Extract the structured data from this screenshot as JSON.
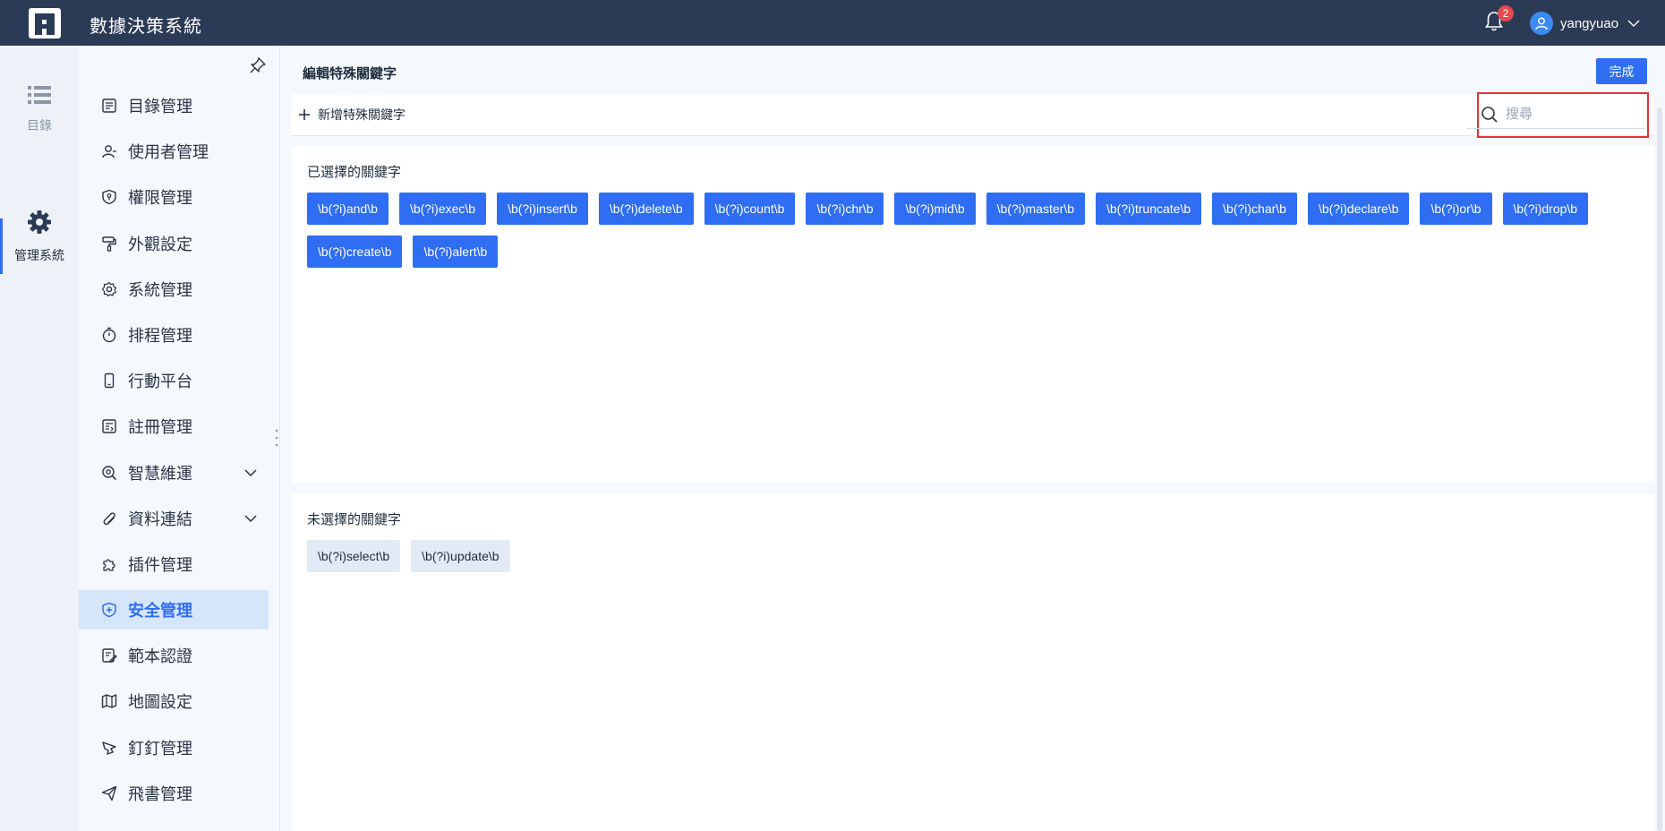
{
  "header": {
    "title": "數據決策系統",
    "notification_count": "2",
    "username": "yangyuao"
  },
  "rail": {
    "items": [
      {
        "label": "目錄",
        "icon": "list-icon"
      },
      {
        "label": "管理系統",
        "icon": "gear-icon"
      }
    ]
  },
  "sidebar": {
    "items": [
      {
        "label": "目錄管理",
        "icon": "catalog-icon"
      },
      {
        "label": "使用者管理",
        "icon": "user-icon"
      },
      {
        "label": "權限管理",
        "icon": "permission-icon"
      },
      {
        "label": "外觀設定",
        "icon": "paint-roller-icon"
      },
      {
        "label": "系統管理",
        "icon": "settings-icon"
      },
      {
        "label": "排程管理",
        "icon": "timer-icon"
      },
      {
        "label": "行動平台",
        "icon": "mobile-icon"
      },
      {
        "label": "註冊管理",
        "icon": "register-icon"
      },
      {
        "label": "智慧維運",
        "icon": "maintenance-icon",
        "expandable": true
      },
      {
        "label": "資料連結",
        "icon": "paperclip-icon",
        "expandable": true
      },
      {
        "label": "插件管理",
        "icon": "puzzle-icon"
      },
      {
        "label": "安全管理",
        "icon": "shield-icon",
        "active": true
      },
      {
        "label": "範本認證",
        "icon": "template-cert-icon"
      },
      {
        "label": "地圖設定",
        "icon": "map-icon"
      },
      {
        "label": "釘釘管理",
        "icon": "dingtalk-icon"
      },
      {
        "label": "飛書管理",
        "icon": "send-icon"
      }
    ]
  },
  "main": {
    "title": "編輯特殊關鍵字",
    "done_label": "完成",
    "add_label": "新增特殊關鍵字",
    "search_placeholder": "搜尋",
    "selected_title": "已選擇的關鍵字",
    "selected_keywords": [
      "\\b(?i)and\\b",
      "\\b(?i)exec\\b",
      "\\b(?i)insert\\b",
      "\\b(?i)delete\\b",
      "\\b(?i)count\\b",
      "\\b(?i)chr\\b",
      "\\b(?i)mid\\b",
      "\\b(?i)master\\b",
      "\\b(?i)truncate\\b",
      "\\b(?i)char\\b",
      "\\b(?i)declare\\b",
      "\\b(?i)or\\b",
      "\\b(?i)drop\\b",
      "\\b(?i)create\\b",
      "\\b(?i)alert\\b"
    ],
    "unselected_title": "未選擇的關鍵字",
    "unselected_keywords": [
      "\\b(?i)select\\b",
      "\\b(?i)update\\b"
    ]
  },
  "colors": {
    "topbar": "#2b3a55",
    "accent": "#2f6df2",
    "active_menu_bg": "#d5e6fb",
    "highlight_box": "#e0353b"
  }
}
